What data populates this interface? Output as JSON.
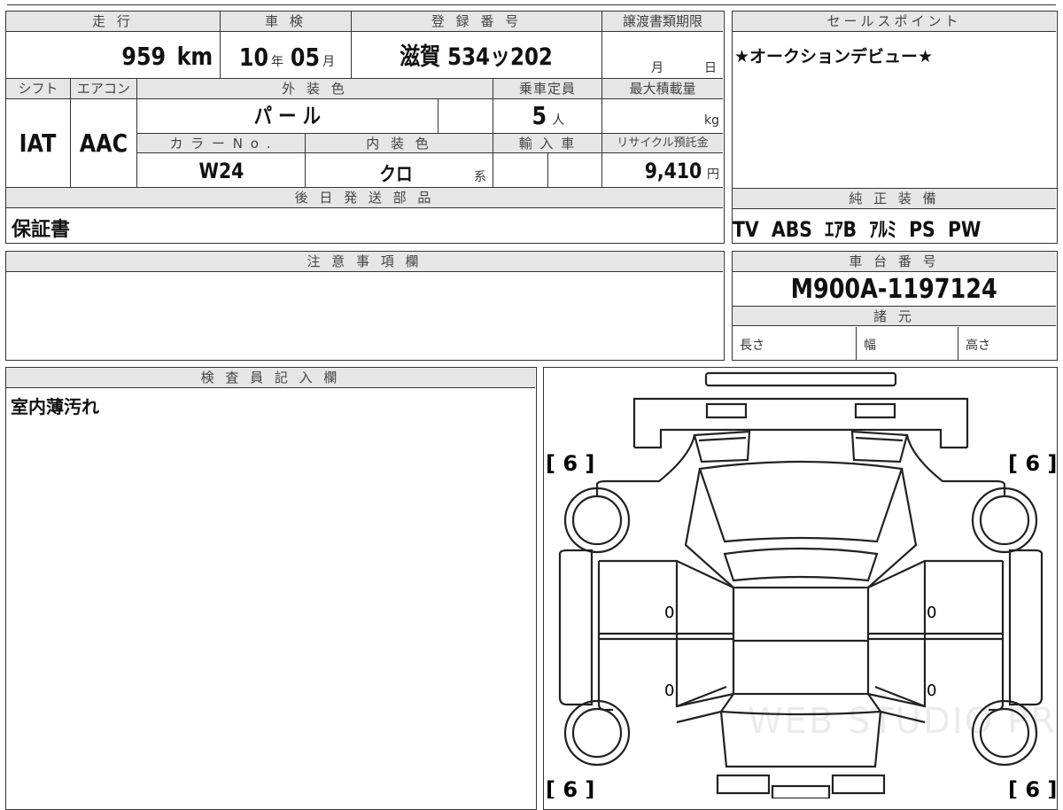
{
  "headers": {
    "mileage": "走 行",
    "inspection": "車 検",
    "registration": "登 録 番 号",
    "transfer_deadline": "譲渡書類期限",
    "shift": "シフト",
    "aircon": "エアコン",
    "exterior_color": "外 装 色",
    "capacity": "乗車定員",
    "max_load": "最大積載量",
    "color_no": "カ ラ ー N o .",
    "interior_color": "内 装 色",
    "import": "輸 入 車",
    "recycle": "リサイクル預託金",
    "later_parts": "後 日 発 送 部 品",
    "sales_point": "セールスポイント",
    "equipment": "純 正 装 備",
    "notes": "注 意 事 項 欄",
    "chassis_no": "車 台 番 号",
    "specs": "諸 元",
    "inspector": "検 査 員 記 入 欄"
  },
  "values": {
    "mileage": "959",
    "mileage_unit": "km",
    "inspection_year": "10",
    "year_unit": "年",
    "inspection_month": "05",
    "month_unit": "月",
    "registration": "滋賀 534ッ202",
    "deadline_month": "月",
    "deadline_day": "日",
    "shift": "IAT",
    "aircon": "AAC",
    "exterior_color": "パ ー ル",
    "capacity": "5",
    "capacity_unit": "人",
    "max_load_unit": "kg",
    "color_no": "W24",
    "interior_color": "クロ",
    "interior_suffix": "系",
    "recycle": "9,410",
    "recycle_unit": "円",
    "later_parts": "保証書",
    "sales_point": "★オークションデビュー★",
    "equipment": "TV  ABS  ｴｱB  ｱﾙﾐ  PS  PW",
    "chassis_no": "M900A-1197124",
    "spec_length": "長さ",
    "spec_width": "幅",
    "spec_height": "高さ",
    "inspector_note": "室内薄汚れ"
  },
  "diagram": {
    "grade_marks": [
      "[ 6 ]",
      "[ 6 ]",
      "[ 6 ]",
      "[ 6 ]"
    ],
    "side_marks": [
      "0",
      "0",
      "0",
      "0"
    ],
    "watermark": "WEB STUDIO PRO"
  }
}
